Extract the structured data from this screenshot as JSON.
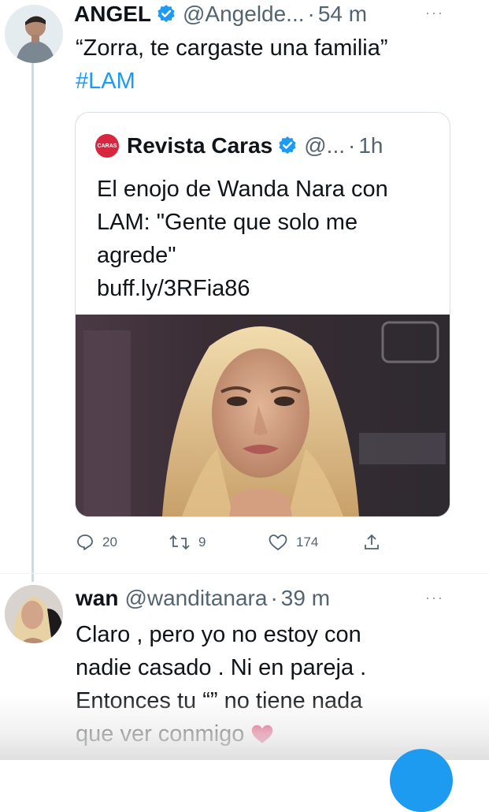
{
  "tweet1": {
    "display_name": "ANGEL",
    "handle": "@Angelde...",
    "separator": "·",
    "time": "54 m",
    "more_icon": "more-horizontal-icon",
    "text_line1": "“Zorra, te cargaste una familia”",
    "hashtag": "#LAM",
    "quote": {
      "logo_text": "CARAS",
      "display_name": "Revista Caras",
      "handle": "@...",
      "separator": "·",
      "time": "1h",
      "text_line1": "El enojo de Wanda Nara con",
      "text_line2": "LAM: \"Gente que solo me",
      "text_line3": "agrede\"",
      "link": "buff.ly/3RFia86"
    },
    "actions": {
      "reply_count": "20",
      "retweet_count": "9",
      "like_count": "174"
    }
  },
  "tweet2": {
    "display_name": "wan",
    "handle": "@wanditanara",
    "separator": "·",
    "time": "39 m",
    "text_line1": "Claro , pero yo no estoy con",
    "text_line2": "nadie casado . Ni en pareja .",
    "text_line3": "Entonces tu “” no tiene nada",
    "text_line4": "que ver conmigo"
  },
  "colors": {
    "accent": "#1d9bf0",
    "text": "#0f1419",
    "muted": "#536471",
    "heart": "#e0245e",
    "caras_red": "#d7263d"
  }
}
